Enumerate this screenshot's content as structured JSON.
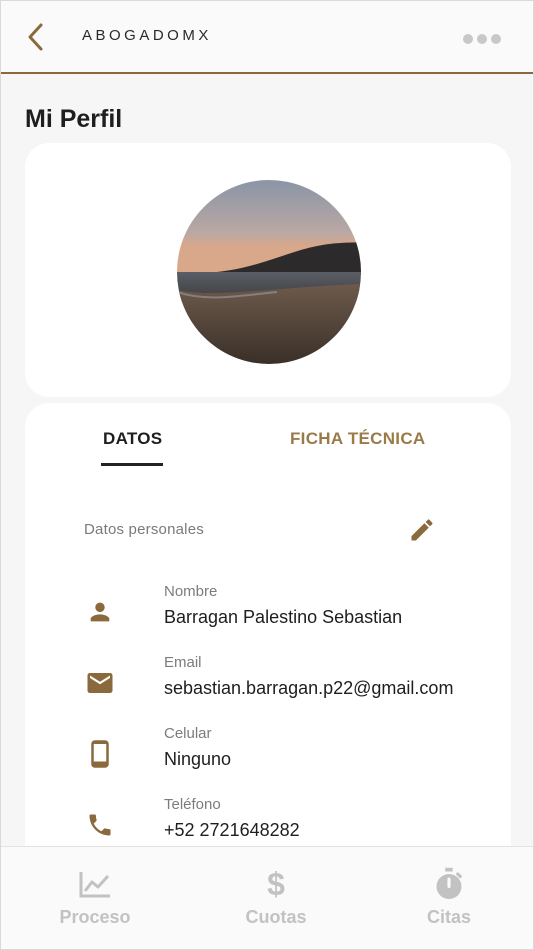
{
  "header": {
    "app_title": "ABOGADOMX",
    "back_icon": "chevron-left-icon",
    "more_icon": "more-horizontal-icon",
    "accent_color": "#8a6a3c"
  },
  "page": {
    "title": "Mi Perfil"
  },
  "profile": {
    "avatar_description_icon": "profile-photo"
  },
  "tabs": [
    {
      "label": "DATOS",
      "active": true
    },
    {
      "label": "FICHA TÉCNICA",
      "active": false
    }
  ],
  "personal": {
    "section_label": "Datos personales",
    "edit_icon": "pencil-icon",
    "fields": [
      {
        "label": "Nombre",
        "value": "Barragan Palestino Sebastian",
        "icon": "person-icon"
      },
      {
        "label": "Email",
        "value": "sebastian.barragan.p22@gmail.com",
        "icon": "mail-icon"
      },
      {
        "label": "Celular",
        "value": "Ninguno",
        "icon": "smartphone-icon"
      },
      {
        "label": "Teléfono",
        "value": "+52 2721648282",
        "icon": "phone-icon"
      }
    ]
  },
  "bottom_nav": [
    {
      "label": "Proceso",
      "icon": "trending-up-icon"
    },
    {
      "label": "Cuotas",
      "icon": "dollar-icon"
    },
    {
      "label": "Citas",
      "icon": "stopwatch-icon"
    }
  ],
  "colors": {
    "brand_brown": "#8a6a3c",
    "tab_inactive": "#9a7a48",
    "nav_inactive": "#c2c2c2"
  }
}
